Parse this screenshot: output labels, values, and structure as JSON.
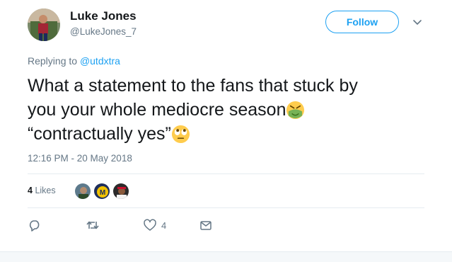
{
  "user": {
    "name": "Luke Jones",
    "handle": "@LukeJones_7"
  },
  "follow_label": "Follow",
  "reply": {
    "prefix": "Replying to ",
    "handle": "@utdxtra"
  },
  "tweet": {
    "line1": "What a statement to the fans that stuck by",
    "line2": "you your whole mediocre season",
    "line3": "“contractually yes”",
    "emoji1": "nauseated-face-emoji",
    "emoji2": "face-with-rolling-eyes-emoji"
  },
  "timestamp": "12:16 PM - 20 May 2018",
  "likes": {
    "count": "4",
    "label": "Likes"
  },
  "actions": {
    "like_count": "4"
  },
  "colors": {
    "accent": "#1da1f2",
    "secondary_text": "#657786",
    "divider": "#e6ecf0"
  }
}
